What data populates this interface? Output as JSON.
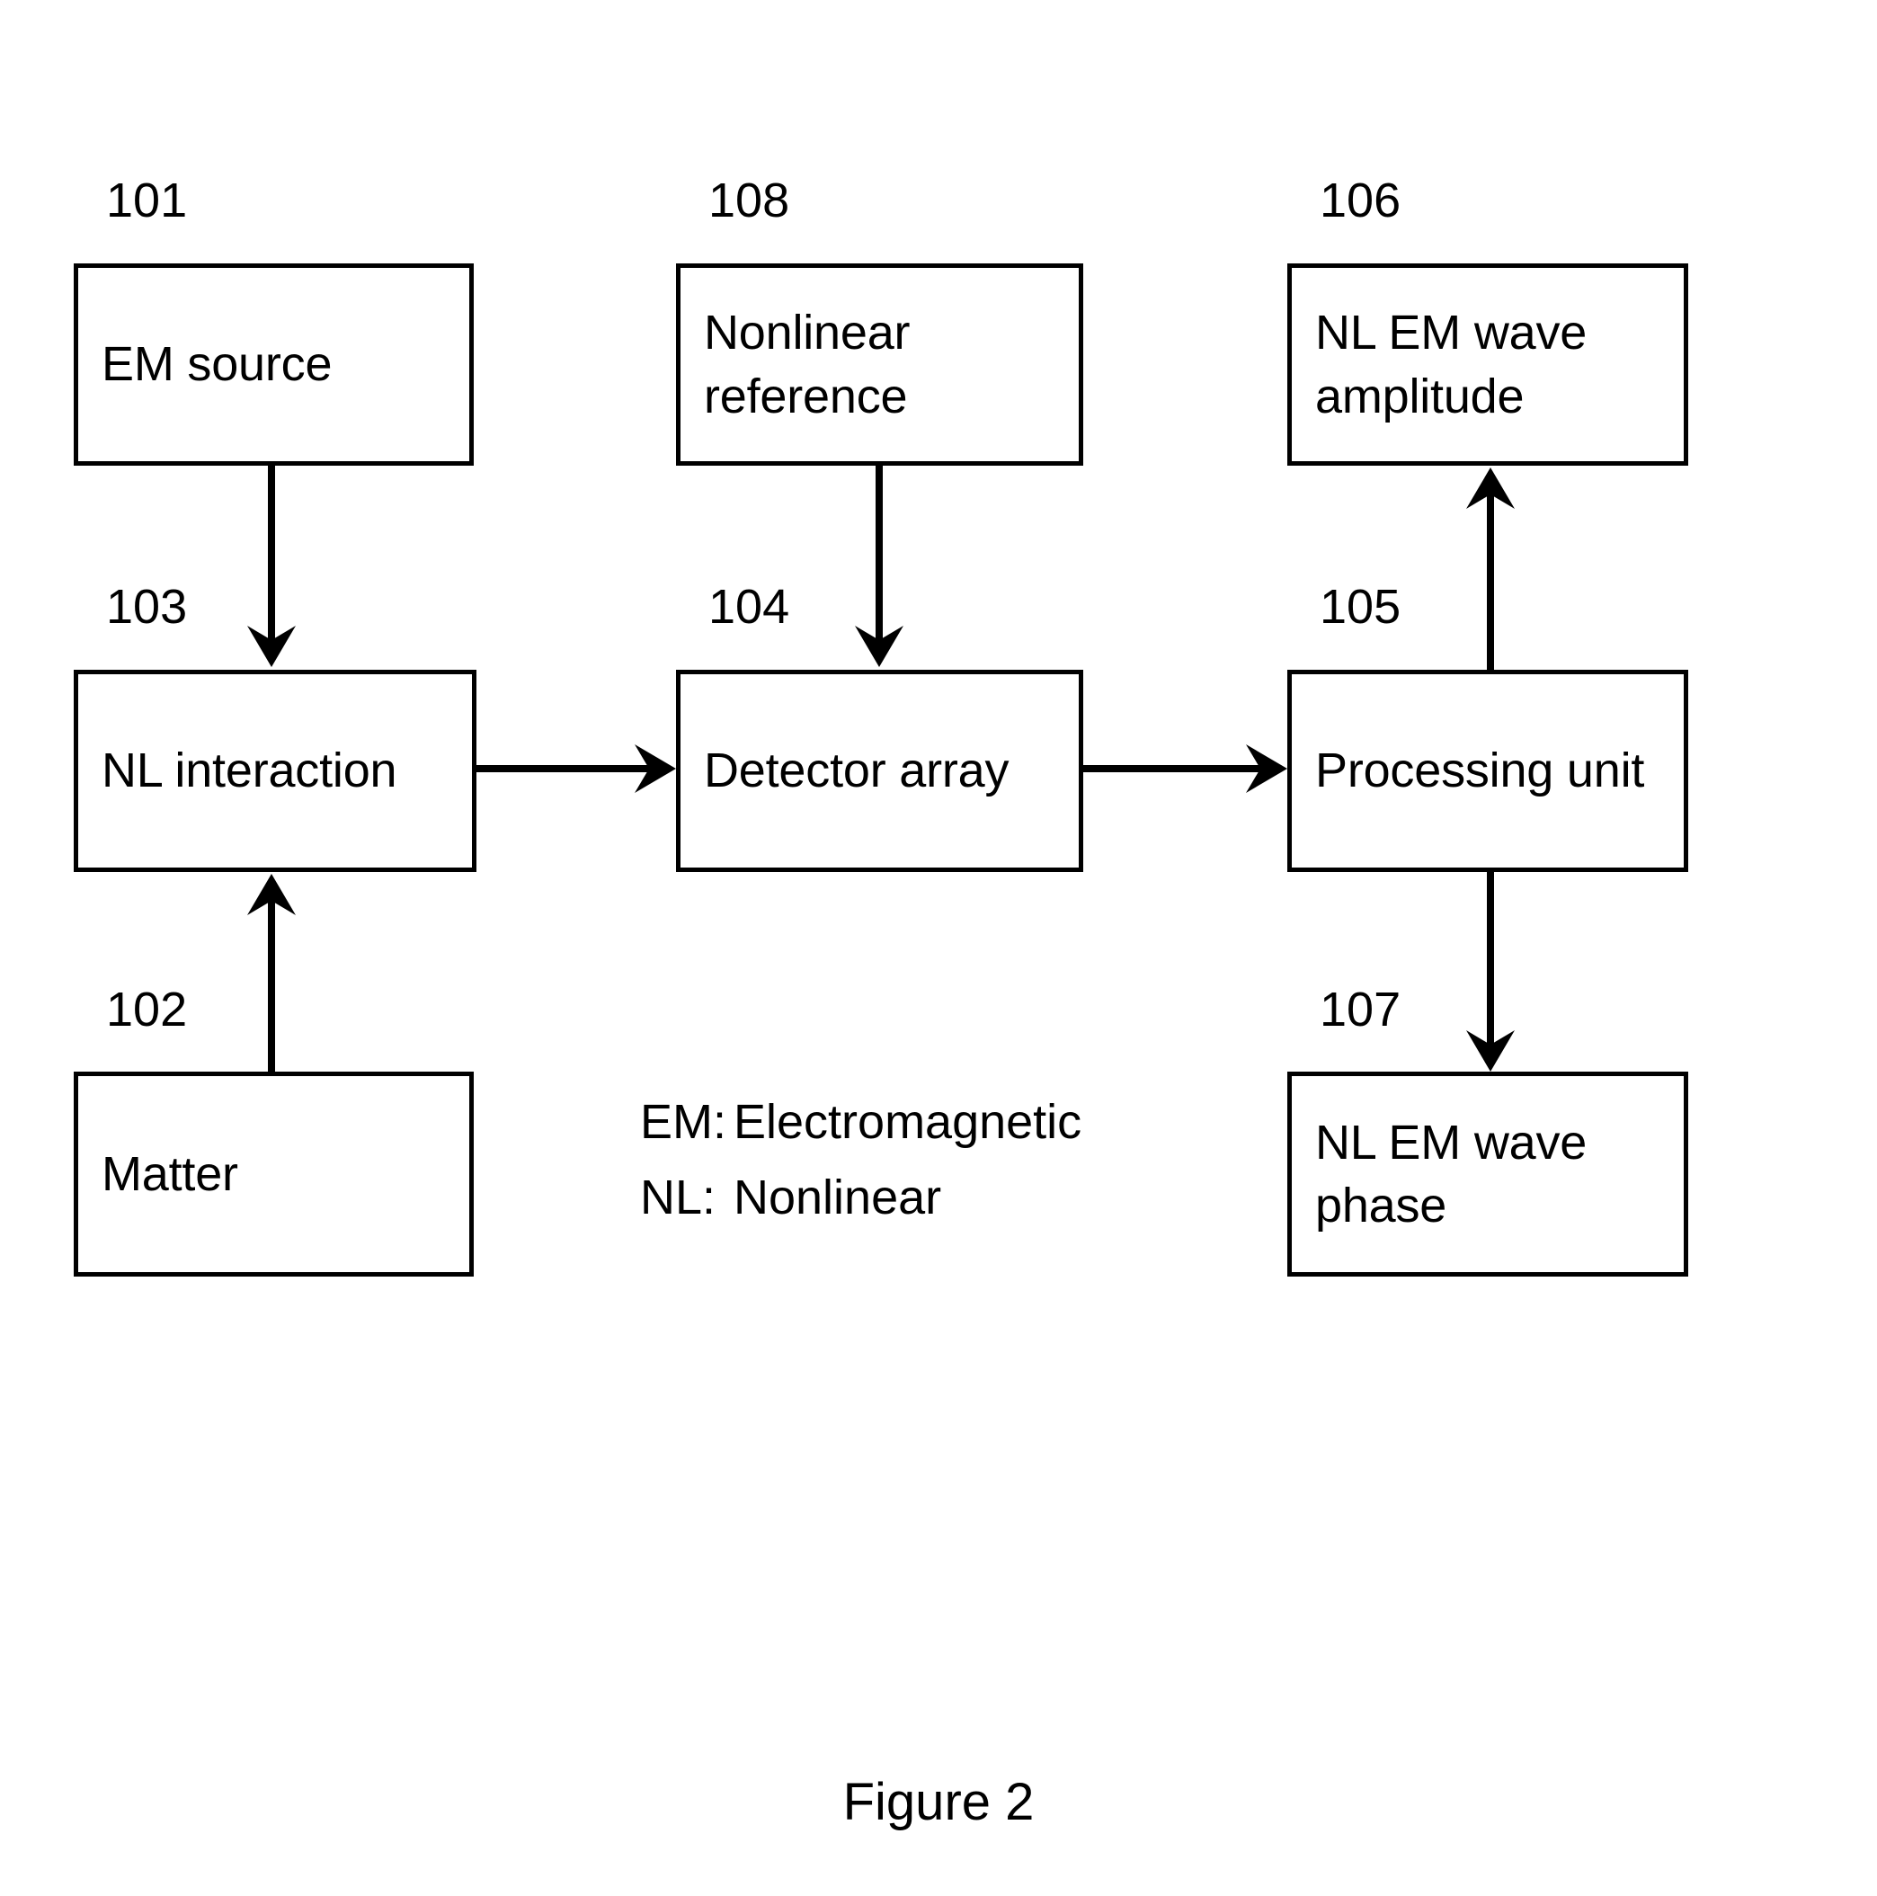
{
  "figure": {
    "caption": "Figure 2"
  },
  "nodes": [
    {
      "ref": "101",
      "label": "EM source"
    },
    {
      "ref": "102",
      "label": "Matter"
    },
    {
      "ref": "103",
      "label": "NL interaction"
    },
    {
      "ref": "104",
      "label": "Detector array"
    },
    {
      "ref": "105",
      "label": "Processing unit"
    },
    {
      "ref": "106",
      "label": "NL EM wave\namplitude"
    },
    {
      "ref": "107",
      "label": "NL EM wave\nphase"
    },
    {
      "ref": "108",
      "label": "Nonlinear\nreference"
    }
  ],
  "legend": [
    {
      "key": "EM:",
      "value": "Electromagnetic"
    },
    {
      "key": "NL:",
      "value": "Nonlinear"
    }
  ],
  "connections": [
    {
      "from": "101",
      "to": "103",
      "direction": "down"
    },
    {
      "from": "102",
      "to": "103",
      "direction": "up"
    },
    {
      "from": "103",
      "to": "104",
      "direction": "right"
    },
    {
      "from": "108",
      "to": "104",
      "direction": "down"
    },
    {
      "from": "104",
      "to": "105",
      "direction": "right"
    },
    {
      "from": "105",
      "to": "106",
      "direction": "up"
    },
    {
      "from": "105",
      "to": "107",
      "direction": "down"
    }
  ],
  "colors": {
    "stroke": "#000000",
    "background": "#ffffff"
  }
}
